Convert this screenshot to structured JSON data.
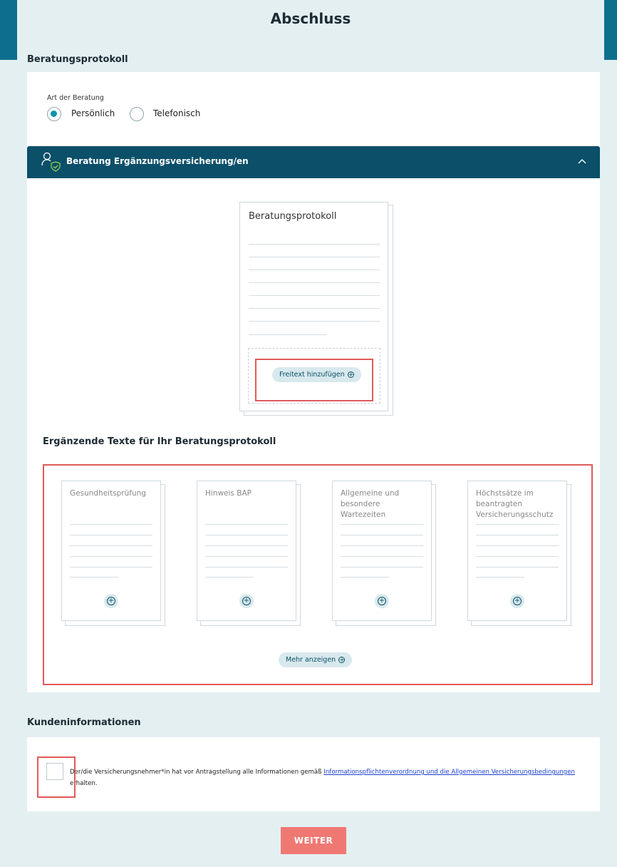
{
  "page": {
    "title": "Abschluss"
  },
  "beratungsprotokoll_section": {
    "heading": "Beratungsprotokoll",
    "art_label": "Art der Beratung",
    "options": [
      {
        "label": "Persönlich",
        "selected": true
      },
      {
        "label": "Telefonisch",
        "selected": false
      }
    ]
  },
  "accordion": {
    "title": "Beratung Ergänzungsversicherung/en",
    "icon": "user-shield-icon",
    "expanded": true
  },
  "protocol_document": {
    "title": "Beratungsprotokoll",
    "add_button_label": "Freitext hinzufügen"
  },
  "supplementary": {
    "heading": "Ergänzende Texte für Ihr Beratungsprotokoll",
    "cards": [
      {
        "title": "Gesundheitsprüfung"
      },
      {
        "title": "Hinweis BAP"
      },
      {
        "title": "Allgemeine und besondere Wartezeiten"
      },
      {
        "title": "Höchstsätze im beantragten Versicherungsschutz"
      }
    ],
    "more_label": "Mehr anzeigen"
  },
  "kundeninfo": {
    "heading": "Kundeninformationen",
    "checked": false,
    "text_before": "Der/die Versicherungsnehmer*in hat vor Antragstellung alle Informationen gemäß ",
    "link_text": "Informationspflichtenverordnung und die Allgemeinen Versicherungsbedingungen ",
    "text_after": "erhalten."
  },
  "footer": {
    "next_label": "WEITER"
  },
  "colors": {
    "primary_dark": "#0b4f69",
    "top_band": "#0d6f8c",
    "page_bg": "#e4eff1",
    "accent_teal": "#0e93ad",
    "button_red": "#f07873",
    "highlight_red": "#e05a5a",
    "link_blue": "#1a3fcf"
  }
}
